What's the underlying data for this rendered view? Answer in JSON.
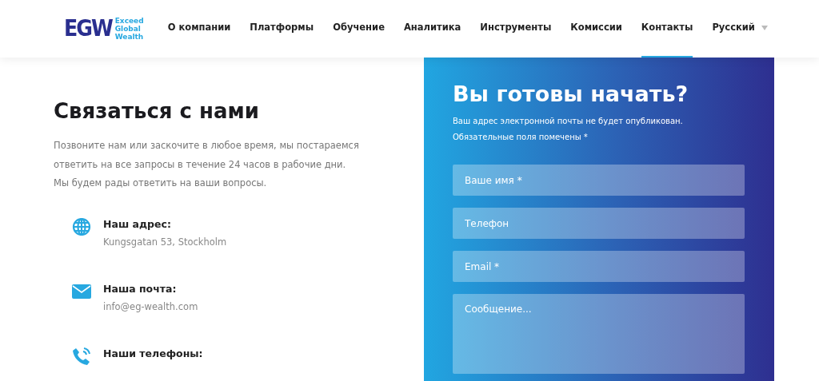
{
  "logo": {
    "mark": "EGW",
    "tagline": [
      "Exceed",
      "Global",
      "Wealth"
    ]
  },
  "nav": [
    {
      "label": "О компании",
      "selected": false
    },
    {
      "label": "Платформы",
      "selected": false
    },
    {
      "label": "Обучение",
      "selected": false
    },
    {
      "label": "Аналитика",
      "selected": false
    },
    {
      "label": "Инструменты",
      "selected": false
    },
    {
      "label": "Комиссии",
      "selected": false
    },
    {
      "label": "Контакты",
      "selected": true
    }
  ],
  "language": {
    "label": "Русский"
  },
  "contact": {
    "title": "Связаться с нами",
    "intro": [
      "Позвоните нам или заскочите в любое время, мы постараемся",
      "ответить на все запросы в течение 24 часов в рабочие дни.",
      "Мы будем рады ответить на ваши вопросы."
    ],
    "items": [
      {
        "kind": "address",
        "title": "Наш адрес:",
        "value": "Kungsgatan 53, Stockholm"
      },
      {
        "kind": "email",
        "title": "Наша почта:",
        "value": "info@eg-wealth.com"
      },
      {
        "kind": "phone",
        "title": "Наши телефоны:"
      }
    ]
  },
  "form": {
    "title": "Вы готовы начать?",
    "note": "Ваш адрес электронной почты не будет опубликован. Обязательные поля помечены *",
    "fields": [
      {
        "kind": "input",
        "placeholder": "Ваше имя *"
      },
      {
        "kind": "input",
        "placeholder": "Телефон"
      },
      {
        "kind": "input",
        "placeholder": "Email *"
      },
      {
        "kind": "textarea",
        "placeholder": "Сообщение..."
      }
    ]
  }
}
